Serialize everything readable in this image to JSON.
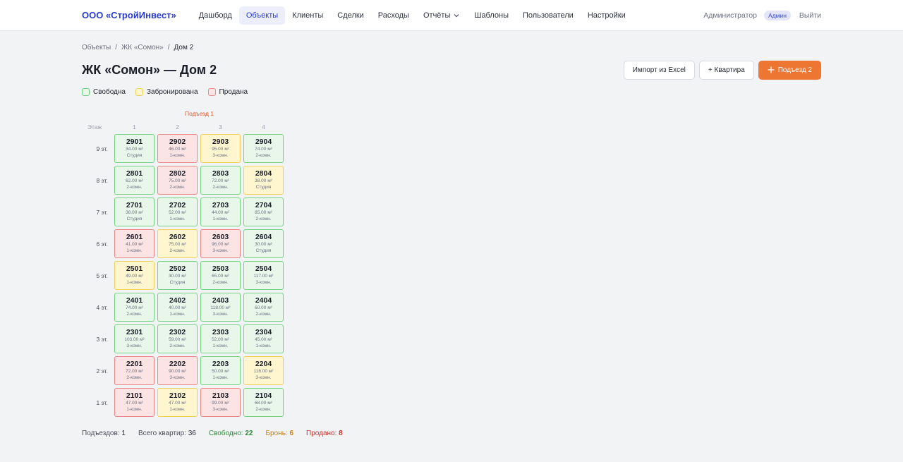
{
  "brand": "ООО «СтройИнвест»",
  "nav": [
    {
      "label": "Дашборд",
      "active": false
    },
    {
      "label": "Объекты",
      "active": true
    },
    {
      "label": "Клиенты",
      "active": false
    },
    {
      "label": "Сделки",
      "active": false
    },
    {
      "label": "Расходы",
      "active": false
    },
    {
      "label": "Отчёты",
      "active": false,
      "dropdown": true
    },
    {
      "label": "Шаблоны",
      "active": false
    },
    {
      "label": "Пользователи",
      "active": false
    },
    {
      "label": "Настройки",
      "active": false
    }
  ],
  "user": {
    "name": "Администратор",
    "role_badge": "Админ",
    "logout": "Выйти"
  },
  "breadcrumb": [
    "Объекты",
    "ЖК «Сомон»",
    "Дом 2"
  ],
  "page_title": "ЖК «Сомон» — Дом 2",
  "actions": {
    "import": "Импорт из Excel",
    "add_apartment": "+ Квартира",
    "add_entrance": "Подъезд 2"
  },
  "legend": {
    "free": "Свободна",
    "reserved": "Забронирована",
    "sold": "Продана"
  },
  "entrance": {
    "label": "Подъезд 1",
    "floor_header": "Этаж",
    "columns": [
      "1",
      "2",
      "3",
      "4"
    ],
    "floors": [
      {
        "label": "9 эт.",
        "apartments": [
          {
            "num": "2901",
            "area": "34.00 м²",
            "type": "Студия",
            "status": "free"
          },
          {
            "num": "2902",
            "area": "46.00 м²",
            "type": "1-комн.",
            "status": "sold"
          },
          {
            "num": "2903",
            "area": "95.00 м²",
            "type": "3-комн.",
            "status": "reserved"
          },
          {
            "num": "2904",
            "area": "74.00 м²",
            "type": "2-комн.",
            "status": "free"
          }
        ]
      },
      {
        "label": "8 эт.",
        "apartments": [
          {
            "num": "2801",
            "area": "62.00 м²",
            "type": "2-комн.",
            "status": "free"
          },
          {
            "num": "2802",
            "area": "75.00 м²",
            "type": "2-комн.",
            "status": "sold"
          },
          {
            "num": "2803",
            "area": "72.00 м²",
            "type": "2-комн.",
            "status": "free"
          },
          {
            "num": "2804",
            "area": "38.00 м²",
            "type": "Студия",
            "status": "reserved"
          }
        ]
      },
      {
        "label": "7 эт.",
        "apartments": [
          {
            "num": "2701",
            "area": "38.00 м²",
            "type": "Студия",
            "status": "free"
          },
          {
            "num": "2702",
            "area": "52.00 м²",
            "type": "1-комн.",
            "status": "free"
          },
          {
            "num": "2703",
            "area": "44.00 м²",
            "type": "1-комн.",
            "status": "free"
          },
          {
            "num": "2704",
            "area": "65.00 м²",
            "type": "2-комн.",
            "status": "free"
          }
        ]
      },
      {
        "label": "6 эт.",
        "apartments": [
          {
            "num": "2601",
            "area": "41.00 м²",
            "type": "1-комн.",
            "status": "sold"
          },
          {
            "num": "2602",
            "area": "75.00 м²",
            "type": "2-комн.",
            "status": "reserved"
          },
          {
            "num": "2603",
            "area": "96.00 м²",
            "type": "3-комн.",
            "status": "sold"
          },
          {
            "num": "2604",
            "area": "30.00 м²",
            "type": "Студия",
            "status": "free"
          }
        ]
      },
      {
        "label": "5 эт.",
        "apartments": [
          {
            "num": "2501",
            "area": "49.00 м²",
            "type": "1-комн.",
            "status": "reserved"
          },
          {
            "num": "2502",
            "area": "30.00 м²",
            "type": "Студия",
            "status": "free"
          },
          {
            "num": "2503",
            "area": "65.00 м²",
            "type": "2-комн.",
            "status": "free"
          },
          {
            "num": "2504",
            "area": "117.00 м²",
            "type": "3-комн.",
            "status": "free"
          }
        ]
      },
      {
        "label": "4 эт.",
        "apartments": [
          {
            "num": "2401",
            "area": "74.00 м²",
            "type": "2-комн.",
            "status": "free"
          },
          {
            "num": "2402",
            "area": "40.00 м²",
            "type": "1-комн.",
            "status": "free"
          },
          {
            "num": "2403",
            "area": "118.00 м²",
            "type": "3-комн.",
            "status": "free"
          },
          {
            "num": "2404",
            "area": "60.00 м²",
            "type": "2-комн.",
            "status": "free"
          }
        ]
      },
      {
        "label": "3 эт.",
        "apartments": [
          {
            "num": "2301",
            "area": "103.00 м²",
            "type": "3-комн.",
            "status": "free"
          },
          {
            "num": "2302",
            "area": "59.00 м²",
            "type": "2-комн.",
            "status": "free"
          },
          {
            "num": "2303",
            "area": "52.00 м²",
            "type": "1-комн.",
            "status": "free"
          },
          {
            "num": "2304",
            "area": "45.00 м²",
            "type": "1-комн.",
            "status": "free"
          }
        ]
      },
      {
        "label": "2 эт.",
        "apartments": [
          {
            "num": "2201",
            "area": "72.00 м²",
            "type": "2-комн.",
            "status": "sold"
          },
          {
            "num": "2202",
            "area": "90.00 м²",
            "type": "3-комн.",
            "status": "sold"
          },
          {
            "num": "2203",
            "area": "50.00 м²",
            "type": "1-комн.",
            "status": "free"
          },
          {
            "num": "2204",
            "area": "116.00 м²",
            "type": "3-комн.",
            "status": "reserved"
          }
        ]
      },
      {
        "label": "1 эт.",
        "apartments": [
          {
            "num": "2101",
            "area": "47.00 м²",
            "type": "1-комн.",
            "status": "sold"
          },
          {
            "num": "2102",
            "area": "47.00 м²",
            "type": "1-комн.",
            "status": "reserved"
          },
          {
            "num": "2103",
            "area": "99.00 м²",
            "type": "3-комн.",
            "status": "sold"
          },
          {
            "num": "2104",
            "area": "68.00 м²",
            "type": "2-комн.",
            "status": "free"
          }
        ]
      }
    ]
  },
  "summary": {
    "entrances_label": "Подъездов:",
    "entrances": "1",
    "total_label": "Всего квартир:",
    "total": "36",
    "free_label": "Свободно:",
    "free": "22",
    "reserved_label": "Бронь:",
    "reserved": "6",
    "sold_label": "Продано:",
    "sold": "8"
  },
  "colors": {
    "brand": "#2a3bd1",
    "accent": "#ed7633",
    "free": "#72d381",
    "reserved": "#f0d05c",
    "sold": "#ea8686"
  }
}
